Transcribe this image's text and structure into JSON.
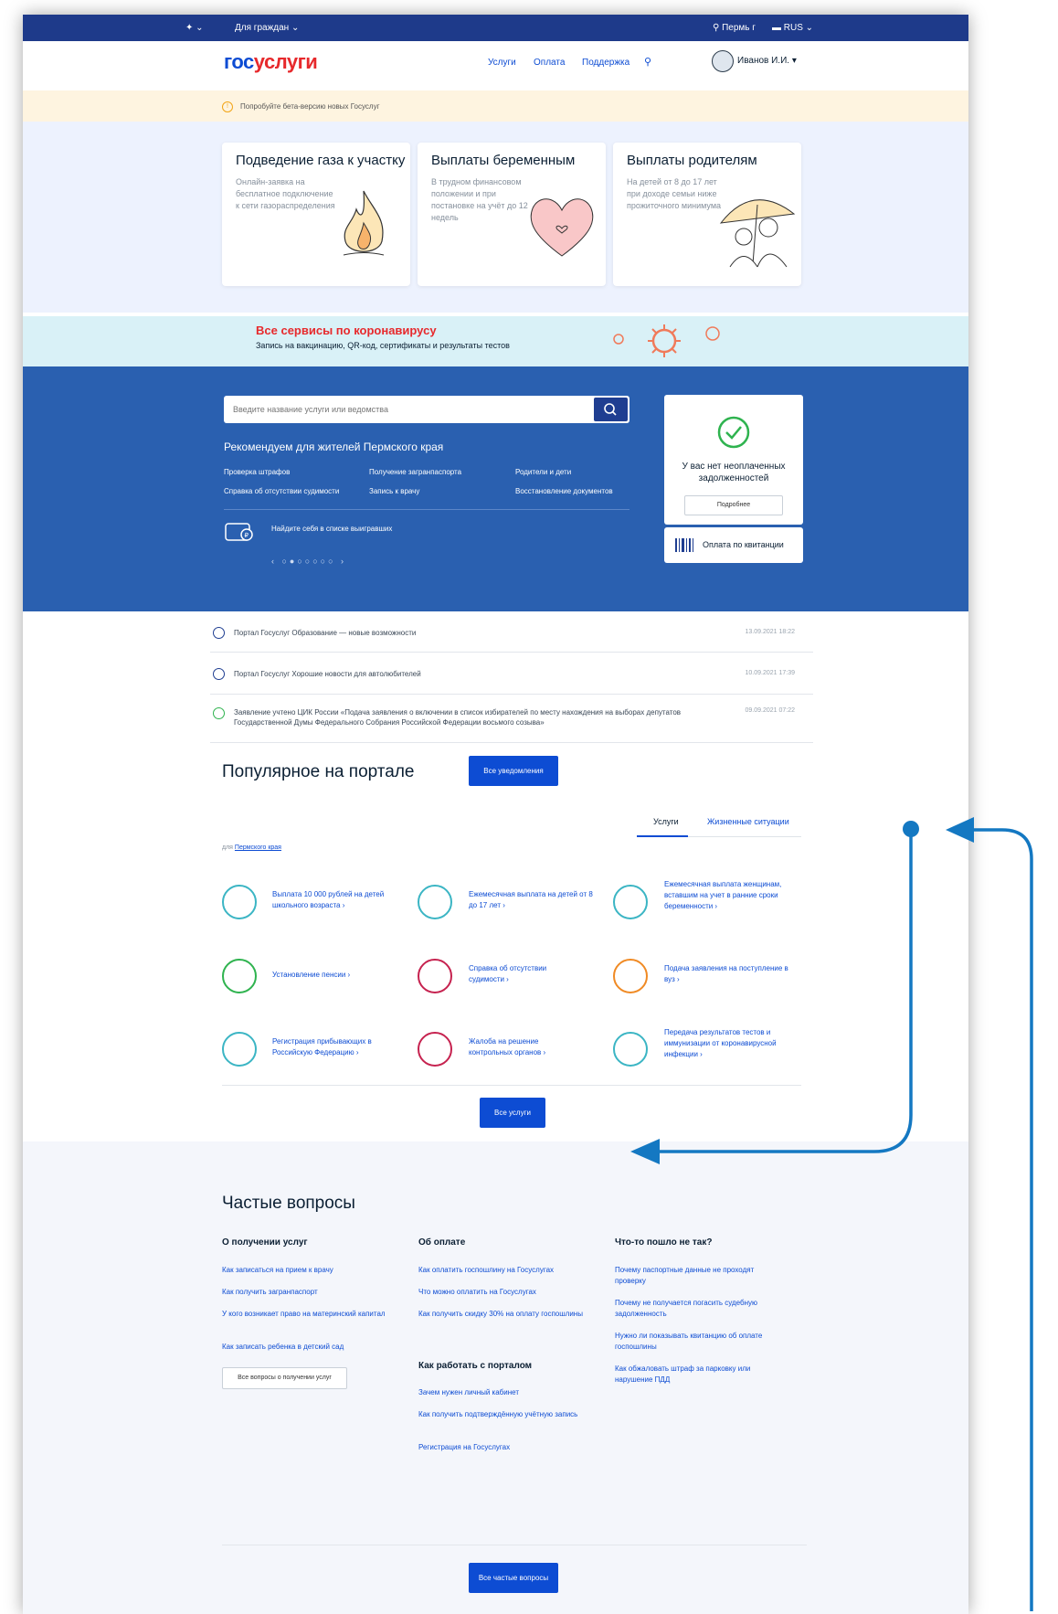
{
  "topbar": {
    "citizens": "Для граждан",
    "region": "Пермь г",
    "lang": "RUS"
  },
  "header": {
    "logo_a": "гос",
    "logo_b": "услуги",
    "nav": [
      "Услуги",
      "Оплата",
      "Поддержка"
    ],
    "user": "Иванов И.И."
  },
  "beta": {
    "text": "Попробуйте бета-версию новых Госуслуг"
  },
  "cards": [
    {
      "title": "Подведение газа к участку",
      "text": "Онлайн-заявка на бесплатное подключение к сети газораспределения"
    },
    {
      "title": "Выплаты беременным",
      "text": "В трудном финансовом положении и при постановке на учёт до 12 недель"
    },
    {
      "title": "Выплаты родителям",
      "text": "На детей от 8 до 17 лет при доходе семьи ниже прожиточного минимума"
    }
  ],
  "covid": {
    "title": "Все сервисы по коронавирусу",
    "subtitle": "Запись на вакцинацию, QR-код, сертификаты и результаты тестов"
  },
  "search": {
    "placeholder": "Введите название услуги или ведомства"
  },
  "recommend": {
    "title": "Рекомендуем для жителей Пермского края",
    "links": [
      "Проверка штрафов",
      "Получение загранпаспорта",
      "Родители и дети",
      "Справка об отсутствии судимости",
      "Запись к врачу",
      "Восстановление документов"
    ],
    "lottery": "Найдите себя в списке выигравших"
  },
  "debt": {
    "text": "У вас нет неоплаченных задолженностей",
    "more": "Подробнее",
    "pay": "Оплата по квитанции"
  },
  "notices": [
    {
      "text": "Портал Госуслуг Образование — новые возможности",
      "date": "13.09.2021 18:22"
    },
    {
      "text": "Портал Госуслуг Хорошие новости для автолюбителей",
      "date": "10.09.2021 17:39"
    },
    {
      "text": "Заявление учтено ЦИК России «Подача заявления о включении в список избирателей по месту нахождения на выборах депутатов Государственной Думы Федерального Собрания Российской Федерации восьмого созыва»",
      "date": "09.09.2021 07:22"
    }
  ],
  "all_notices": "Все уведомления",
  "popular": {
    "title": "Популярное на портале",
    "for": "для",
    "region": "Пермского края",
    "tabs": [
      "Услуги",
      "Жизненные ситуации"
    ],
    "services": [
      "Выплата 10 000 рублей на детей школьного возраста ›",
      "Ежемесячная выплата на детей от 8 до 17 лет ›",
      "Ежемесячная выплата женщинам, вставшим на учет в ранние сроки беременности ›",
      "Установление пенсии ›",
      "Справка об отсутствии судимости ›",
      "Подача заявления на поступление в вуз ›",
      "Регистрация прибывающих в Российскую Федерацию ›",
      "Жалоба на решение контрольных органов ›",
      "Передача результатов тестов и иммунизации от коронавирусной инфекции ›"
    ],
    "all": "Все услуги"
  },
  "faq": {
    "title": "Частые вопросы",
    "col1_h": "О получении услуг",
    "col1": [
      "Как записаться на прием к врачу",
      "Как получить загранпаспорт",
      "У кого возникает право на материнский капитал",
      "Как записать ребенка в детский сад"
    ],
    "col1_btn": "Все вопросы о получении услуг",
    "col2_h": "Об оплате",
    "col2": [
      "Как оплатить госпошлину на Госуслугах",
      "Что можно оплатить на Госуслугах",
      "Как получить скидку 30% на оплату госпошлины"
    ],
    "col2b_h": "Как работать с порталом",
    "col2b": [
      "Зачем нужен личный кабинет",
      "Как получить подтверждённую учётную запись",
      "Регистрация на Госуслугах"
    ],
    "col3_h": "Что-то пошло не так?",
    "col3": [
      "Почему паспортные данные не проходят проверку",
      "Почему не получается погасить судебную задолженность",
      "Нужно ли показывать квитанцию об оплате госпошлины",
      "Как обжаловать штраф за парковку или нарушение ПДД"
    ],
    "all": "Все частые вопросы"
  },
  "colors": {
    "primary": "#0d4cd3",
    "dark_blue": "#1e3a8a",
    "accent_red": "#e7292c",
    "arrow": "#1478c2"
  }
}
